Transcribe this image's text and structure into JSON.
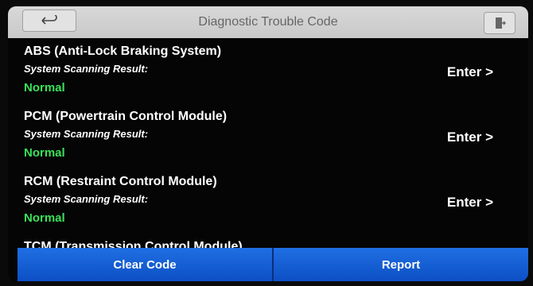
{
  "header": {
    "title": "Diagnostic Trouble Code",
    "back_icon": "back-arrow-icon",
    "exit_icon": "exit-door-icon"
  },
  "systems": [
    {
      "name": "ABS (Anti-Lock Braking System)",
      "label": "System Scanning Result:",
      "status": "Normal",
      "enter": "Enter >"
    },
    {
      "name": "PCM (Powertrain Control Module)",
      "label": "System Scanning Result:",
      "status": "Normal",
      "enter": "Enter >"
    },
    {
      "name": "RCM (Restraint Control Module)",
      "label": "System Scanning Result:",
      "status": "Normal",
      "enter": "Enter >"
    },
    {
      "name": "TCM (Transmission Control Module)",
      "label": "",
      "status": "",
      "enter": ""
    }
  ],
  "footer": {
    "clear_code": "Clear Code",
    "report": "Report"
  },
  "colors": {
    "status_normal": "#3ce05a",
    "footer_button": "#1a66dd",
    "header_bg": "#d0d0d0"
  }
}
